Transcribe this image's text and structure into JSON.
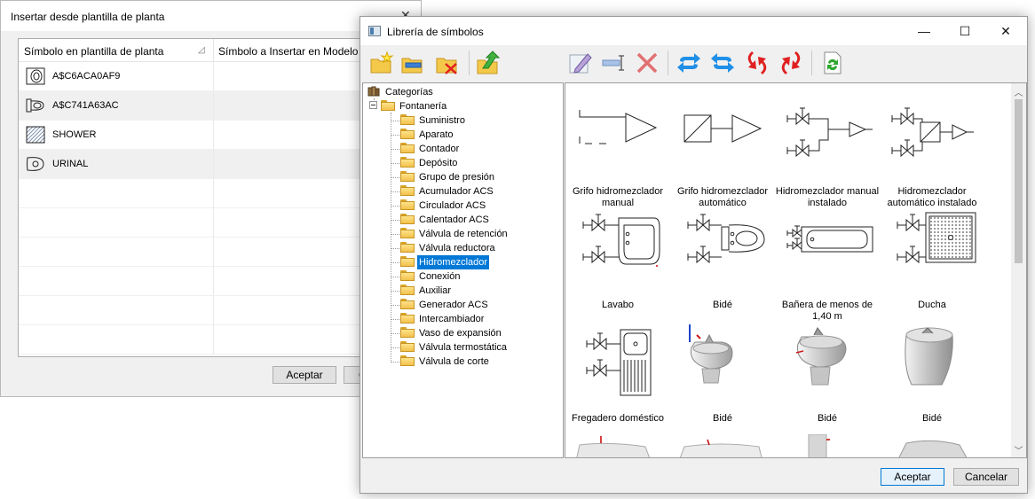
{
  "back_dialog": {
    "title": "Insertar desde plantilla de planta",
    "close_glyph": "✕",
    "columns": [
      "Símbolo en plantilla de planta",
      "Símbolo a Insertar en Modelo"
    ],
    "rows": [
      {
        "name": "A$C6ACA0AF9",
        "icon": "washbasin-icon"
      },
      {
        "name": "A$C741A63AC",
        "icon": "toilet-icon"
      },
      {
        "name": "SHOWER",
        "icon": "shower-icon"
      },
      {
        "name": "URINAL",
        "icon": "urinal-icon"
      }
    ],
    "ok_label": "Aceptar",
    "cancel_label": "C"
  },
  "front_dialog": {
    "title": "Librería de símbolos",
    "window_buttons": {
      "minimize": "—",
      "maximize": "☐",
      "close": "✕"
    },
    "toolbar_icons": [
      "new-folder-icon",
      "rename-folder-icon",
      "delete-folder-icon",
      "import-icon",
      "edit-symbol-icon",
      "rename-symbol-icon",
      "delete-symbol-icon",
      "swap-horizontal-icon",
      "swap-reverse-icon",
      "rotate-cw-icon",
      "rotate-ccw-icon",
      "refresh-icon"
    ],
    "tree": {
      "root": "Categorías",
      "group": "Fontanería",
      "items": [
        "Suministro",
        "Aparato",
        "Contador",
        "Depósito",
        "Grupo de presión",
        "Acumulador ACS",
        "Circulador ACS",
        "Calentador ACS",
        "Válvula de retención",
        "Válvula reductora",
        "Hidromezclador",
        "Conexión",
        "Auxiliar",
        "Generador ACS",
        "Intercambiador",
        "Vaso de expansión",
        "Válvula termostática",
        "Válvula de corte"
      ],
      "selected": "Hidromezclador"
    },
    "symbols": [
      {
        "caption": "Grifo hidromezclador manual",
        "icon": "mixer-tap-manual-icon"
      },
      {
        "caption": "Grifo hidromezclador automático",
        "icon": "mixer-tap-auto-icon"
      },
      {
        "caption": "Hidromezclador manual instalado",
        "icon": "mixer-manual-installed-icon"
      },
      {
        "caption": "Hidromezclador automático instalado",
        "icon": "mixer-auto-installed-icon"
      },
      {
        "caption": "Lavabo",
        "icon": "washbasin-plan-icon"
      },
      {
        "caption": "Bidé",
        "icon": "bidet-plan-icon"
      },
      {
        "caption": "Bañera de menos de 1,40 m",
        "icon": "bathtub-plan-icon"
      },
      {
        "caption": "Ducha",
        "icon": "shower-plan-icon"
      },
      {
        "caption": "Fregadero doméstico",
        "icon": "kitchen-sink-plan-icon"
      },
      {
        "caption": "Bidé",
        "icon": "bidet-3d-icon"
      },
      {
        "caption": "Bidé",
        "icon": "bidet-3d-icon"
      },
      {
        "caption": "Bidé",
        "icon": "bidet-3d-icon"
      }
    ],
    "ok_label": "Aceptar",
    "cancel_label": "Cancelar"
  }
}
